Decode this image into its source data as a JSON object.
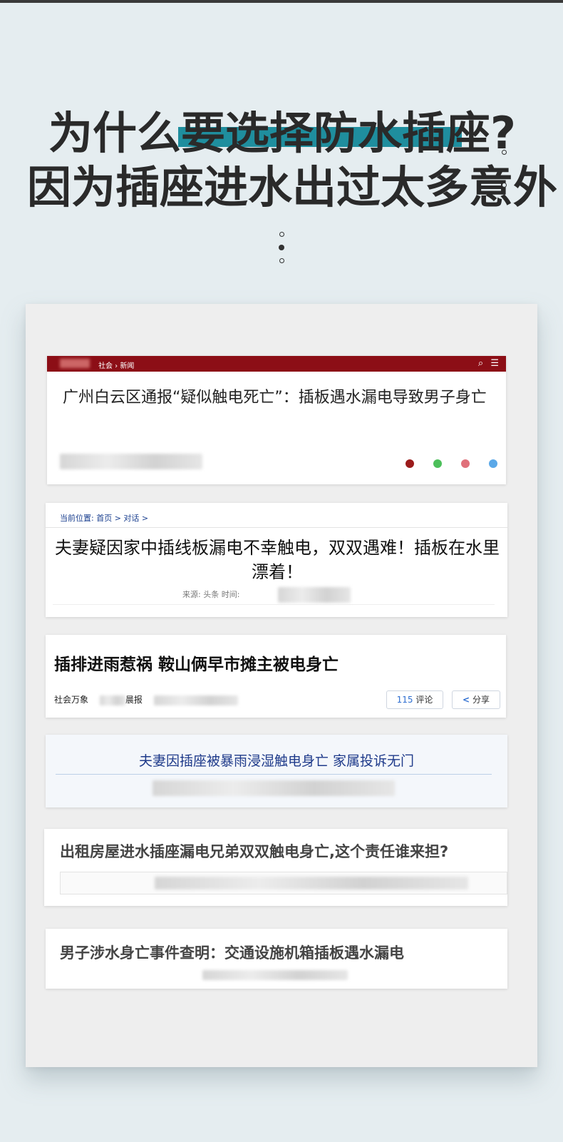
{
  "headline": {
    "line1": "为什么要选择防水插座?",
    "line2": "因为插座进水出过太多意外",
    "accent_color": "#1f8e9e"
  },
  "articles": [
    {
      "header_crumb": "社会 › 新闻",
      "header_icons": "search-icon menu-icon",
      "title": "广州白云区通报“疑似触电死亡”：插板遇水漏电导致男子身亡",
      "brand_color": "#8c0e16"
    },
    {
      "breadcrumb": "当前位置: 首页 > 对话 >",
      "title": "夫妻疑因家中插线板漏电不幸触电，双双遇难！插板在水里漂着！",
      "meta": "来源:      头条      时间:"
    },
    {
      "title": "插排进雨惹祸 鞍山俩早市摊主被电身亡",
      "meta": "社会万象",
      "source_suffix": "晨报",
      "comment_count": "115",
      "comment_label": "评论",
      "share_label": "分享"
    },
    {
      "title": "夫妻因插座被暴雨浸湿触电身亡  家属投诉无门"
    },
    {
      "title": "出租房屋进水插座漏电兄弟双双触电身亡,这个责任谁来担?"
    },
    {
      "title": "男子涉水身亡事件查明：交通设施机箱插板遇水漏电"
    }
  ]
}
